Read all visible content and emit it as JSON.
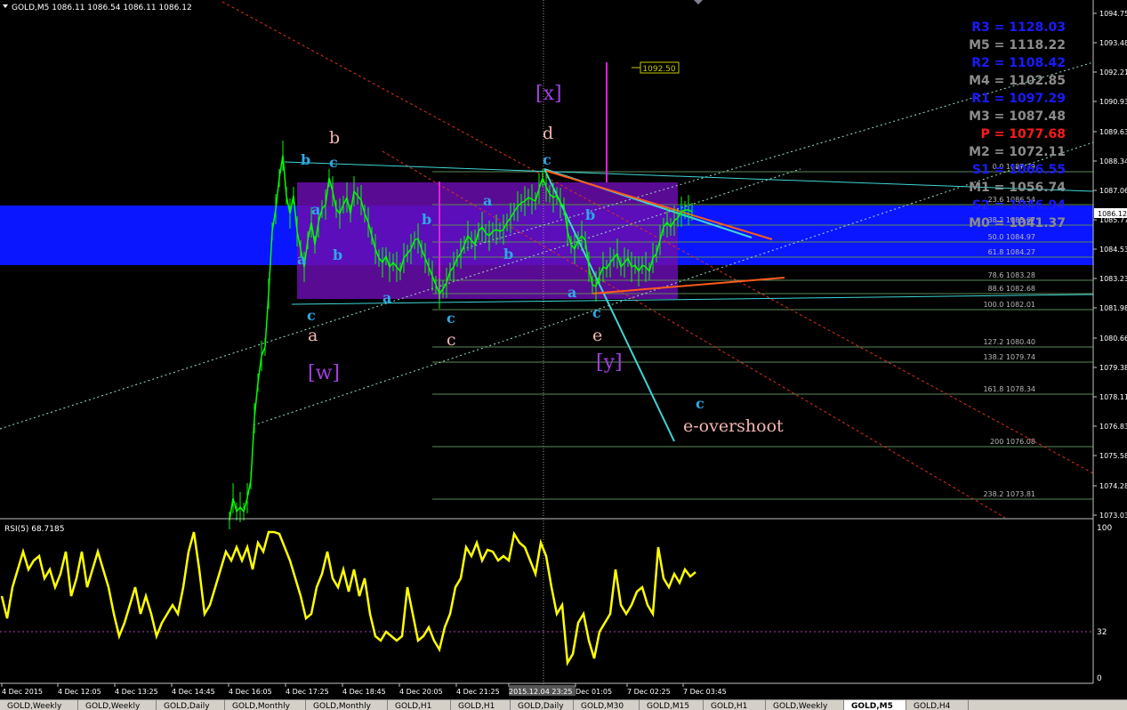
{
  "symbol_info": "GOLD,M5  1086.11 1086.54 1086.11 1086.12",
  "colors": {
    "background": "#000000",
    "candle": "#00ff00",
    "grid": "#606060",
    "fib_line": "#5a8a5a",
    "zone_blue": "#0a16ff",
    "zone_purple": "#6a0dad",
    "rsi_line": "#ffff00",
    "cyan_line": "#3fd6d6",
    "orange_line": "#ff5a1a",
    "magenta_line": "#e020e0"
  },
  "price_axis": {
    "labels": [
      "1094.75",
      "1093.48",
      "1092.21",
      "1090.93",
      "1089.63",
      "1088.34",
      "1087.06",
      "1085.77",
      "1084.53",
      "1083.23",
      "1081.98",
      "1080.66",
      "1079.38",
      "1078.11",
      "1076.83",
      "1075.58",
      "1074.28",
      "1073.03"
    ],
    "current_price": "1086.12"
  },
  "time_axis": {
    "labels": [
      "4 Dec 2015",
      "4 Dec 12:05",
      "4 Dec 13:25",
      "4 Dec 14:45",
      "4 Dec 16:05",
      "4 Dec 17:25",
      "4 Dec 18:45",
      "4 Dec 20:05",
      "4 Dec 21:25",
      "2015.12.04 23:25",
      "Dec 01:05",
      "7 Dec 02:25",
      "7 Dec 03:45"
    ]
  },
  "pivots": [
    {
      "text": "R3 = 1128.03",
      "color": "#1a1aff"
    },
    {
      "text": "M5 = 1118.22",
      "color": "#8c8c8c"
    },
    {
      "text": "R2 = 1108.42",
      "color": "#1a1aff"
    },
    {
      "text": "M4 = 1102.85",
      "color": "#8c8c8c"
    },
    {
      "text": "R1 = 1097.29",
      "color": "#1a1aff"
    },
    {
      "text": "M3 = 1087.48",
      "color": "#8c8c8c"
    },
    {
      "text": "P   = 1077.68",
      "color": "#ff1a1a"
    },
    {
      "text": "M2 = 1072.11",
      "color": "#8c8c8c"
    },
    {
      "text": "S1 = 1066.55",
      "color": "#1a1aff"
    },
    {
      "text": "M1 = 1056.74",
      "color": "#8c8c8c"
    },
    {
      "text": "S2 = 1046.94",
      "color": "#1a1aff"
    },
    {
      "text": "M0 = 1041.37",
      "color": "#8c8c8c"
    }
  ],
  "fib_levels": [
    {
      "text": "0.0  1087.39"
    },
    {
      "text": "23.6  1086.54"
    },
    {
      "text": "38.2  1085.67"
    },
    {
      "text": "50.0  1084.97"
    },
    {
      "text": "61.8  1084.27"
    },
    {
      "text": "78.6  1083.28"
    },
    {
      "text": "88.6  1082.68"
    },
    {
      "text": "100.0  1082.01"
    },
    {
      "text": "127.2  1080.40"
    },
    {
      "text": "138.2  1079.74"
    },
    {
      "text": "161.8  1078.34"
    },
    {
      "text": "200  1076.08"
    },
    {
      "text": "238.2  1073.81"
    }
  ],
  "price_tag": "1092.50",
  "wave_labels": [
    {
      "text": "b",
      "color": "#f4b6b0",
      "size": 19
    },
    {
      "text": "b",
      "color": "#2ea8e8",
      "size": 16
    },
    {
      "text": "c",
      "color": "#2ea8e8",
      "size": 16
    },
    {
      "text": "a",
      "color": "#2ea8e8",
      "size": 16
    },
    {
      "text": "a",
      "color": "#2ea8e8",
      "size": 16
    },
    {
      "text": "b",
      "color": "#2ea8e8",
      "size": 16
    },
    {
      "text": "c",
      "color": "#2ea8e8",
      "size": 16
    },
    {
      "text": "a",
      "color": "#f4b6b0",
      "size": 19
    },
    {
      "text": "[w]",
      "color": "#a040e0",
      "size": 22
    },
    {
      "text": "a",
      "color": "#2ea8e8",
      "size": 16
    },
    {
      "text": "b",
      "color": "#2ea8e8",
      "size": 16
    },
    {
      "text": "a",
      "color": "#2ea8e8",
      "size": 16
    },
    {
      "text": "b",
      "color": "#2ea8e8",
      "size": 16
    },
    {
      "text": "c",
      "color": "#2ea8e8",
      "size": 16
    },
    {
      "text": "c",
      "color": "#f4b6b0",
      "size": 19
    },
    {
      "text": "[x]",
      "color": "#a040e0",
      "size": 22
    },
    {
      "text": "d",
      "color": "#f4b6b0",
      "size": 19
    },
    {
      "text": "c",
      "color": "#2ea8e8",
      "size": 16
    },
    {
      "text": "b",
      "color": "#2ea8e8",
      "size": 16
    },
    {
      "text": "a",
      "color": "#2ea8e8",
      "size": 16
    },
    {
      "text": "c",
      "color": "#2ea8e8",
      "size": 16
    },
    {
      "text": "e",
      "color": "#f4b6b0",
      "size": 19
    },
    {
      "text": "[y]",
      "color": "#a040e0",
      "size": 22
    },
    {
      "text": "c",
      "color": "#2ea8e8",
      "size": 16
    },
    {
      "text": "e-overshoot",
      "color": "#f4b6b0",
      "size": 19
    }
  ],
  "rsi": {
    "label": "RSI(5) 68.7185",
    "levels": [
      "100",
      "32",
      "0"
    ]
  },
  "tabs": [
    "GOLD,Weekly",
    "GOLD,Weekly",
    "GOLD,Daily",
    "GOLD,Monthly",
    "GOLD,Monthly",
    "GOLD,H1",
    "GOLD,H1",
    "GOLD,Daily",
    "GOLD,M30",
    "GOLD,M15",
    "GOLD,H1",
    "GOLD,Weekly",
    "GOLD,M5",
    "GOLD,H4"
  ],
  "active_tab": 12
}
